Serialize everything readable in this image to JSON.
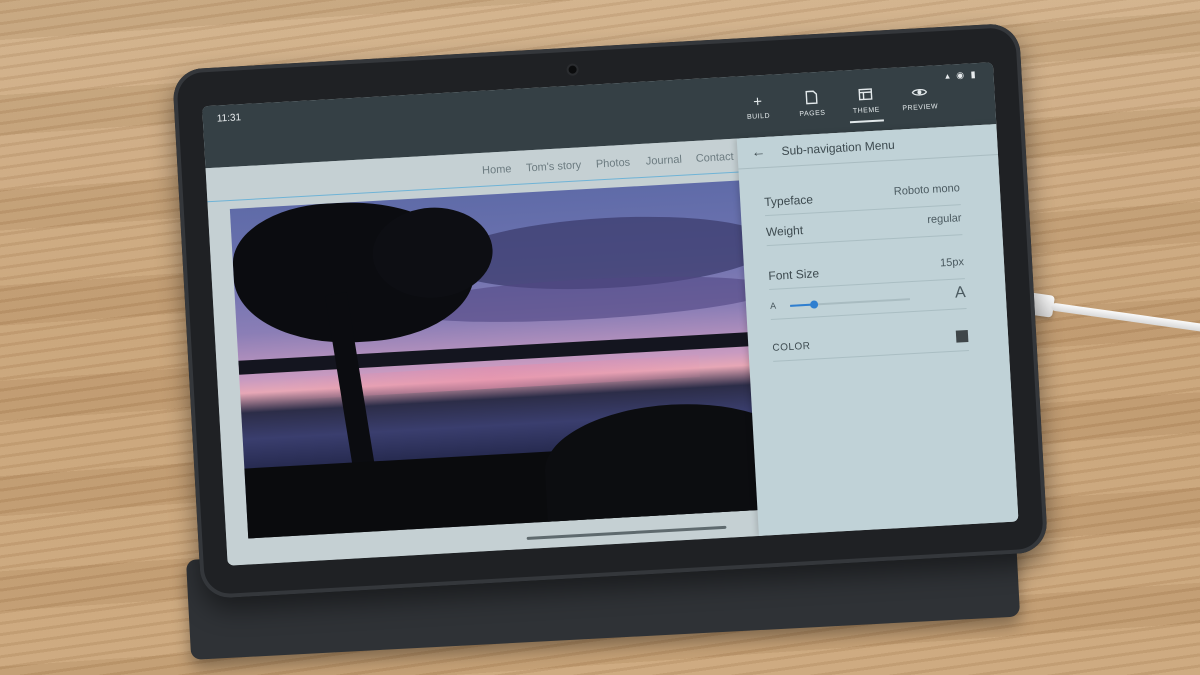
{
  "status": {
    "time": "11:31",
    "icons": "▴ ◉ ▮"
  },
  "toolbar": {
    "build": {
      "icon": "plus-icon",
      "label": "BUILD"
    },
    "pages": {
      "icon": "page-icon",
      "label": "PAGES"
    },
    "theme": {
      "icon": "theme-icon",
      "label": "THEME"
    },
    "preview": {
      "icon": "eye-icon",
      "label": "PREVIEW"
    }
  },
  "site_nav": [
    "Home",
    "Tom's story",
    "Photos",
    "Journal",
    "Contact"
  ],
  "panel": {
    "title": "Sub-navigation Menu",
    "typeface": {
      "label": "Typeface",
      "value": "Roboto mono"
    },
    "weight": {
      "label": "Weight",
      "value": "regular"
    },
    "font_size": {
      "label": "Font Size",
      "value": "15px"
    },
    "slider": {
      "min_label": "A",
      "max_label": "A",
      "level": 0.2
    },
    "color": {
      "label": "COLOR",
      "value": "#3f4649"
    }
  },
  "colors": {
    "accent": "#2f7fd0",
    "topbar": "#354045",
    "panel": "#c0d2d7"
  }
}
